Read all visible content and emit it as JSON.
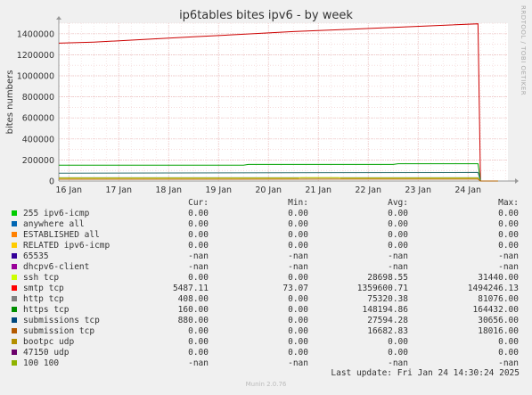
{
  "title": "ip6tables bites ipv6 - by week",
  "side_label": "RRDTOOL / TOBI OETIKER",
  "footer": {
    "last_update": "Last update: Fri Jan 24 14:30:24 2025",
    "munin": "Munin 2.0.76"
  },
  "legend_headers": {
    "cur": "Cur:",
    "min": "Min:",
    "avg": "Avg:",
    "max": "Max:"
  },
  "chart_data": {
    "type": "line",
    "title": "ip6tables bites ipv6 - by week",
    "ylabel": "bites numbers",
    "ylim": [
      0,
      1500000
    ],
    "yticks": [
      0,
      200000,
      400000,
      600000,
      800000,
      1000000,
      1200000,
      1400000
    ],
    "ytick_labels": [
      "0",
      "200000",
      "400000",
      "600000",
      "800000",
      "1000000",
      "1200000",
      "1400000"
    ],
    "xlim_days": [
      15.8,
      24.8
    ],
    "xticks": [
      16,
      17,
      18,
      19,
      20,
      21,
      22,
      23,
      24
    ],
    "xtick_labels": [
      "16 Jan",
      "17 Jan",
      "18 Jan",
      "19 Jan",
      "20 Jan",
      "21 Jan",
      "22 Jan",
      "23 Jan",
      "24 Jan"
    ],
    "grid": true,
    "series": [
      {
        "name": "smtp tcp",
        "color": "#cc0000",
        "x": [
          15.8,
          16.5,
          17.5,
          18.5,
          19.5,
          20.5,
          21.5,
          22.5,
          23.5,
          24.2,
          24.25,
          24.6
        ],
        "y": [
          1310000,
          1320000,
          1345000,
          1370000,
          1395000,
          1420000,
          1440000,
          1460000,
          1480000,
          1494246,
          0,
          0
        ]
      },
      {
        "name": "https tcp",
        "color": "#00a000",
        "x": [
          15.8,
          19.5,
          19.6,
          22.5,
          22.6,
          24.2,
          24.25,
          24.6
        ],
        "y": [
          150000,
          150000,
          158000,
          158000,
          164432,
          164432,
          0,
          0
        ]
      },
      {
        "name": "http tcp",
        "color": "#2f6f6f",
        "x": [
          15.8,
          24.2,
          24.25,
          24.6
        ],
        "y": [
          75000,
          81076,
          0,
          0
        ]
      },
      {
        "name": "submissions tcp",
        "color": "#104040",
        "x": [
          15.8,
          24.2,
          24.25,
          24.6
        ],
        "y": [
          30656,
          30656,
          0,
          0
        ]
      },
      {
        "name": "ssh tcp",
        "color": "#e0e000",
        "x": [
          15.8,
          20.6,
          20.65,
          21.4,
          21.45,
          24.2,
          24.25,
          24.6
        ],
        "y": [
          28000,
          28000,
          31440,
          31440,
          28000,
          28000,
          0,
          0
        ]
      },
      {
        "name": "submission tcp",
        "color": "#b06000",
        "x": [
          15.8,
          24.2,
          24.25,
          24.6
        ],
        "y": [
          16682,
          18016,
          0,
          0
        ]
      }
    ],
    "legend": [
      {
        "name": "255 ipv6-icmp",
        "color": "#00cc00",
        "cur": "0.00",
        "min": "0.00",
        "avg": "0.00",
        "max": "0.00"
      },
      {
        "name": "anywhere all",
        "color": "#0066b3",
        "cur": "0.00",
        "min": "0.00",
        "avg": "0.00",
        "max": "0.00"
      },
      {
        "name": "ESTABLISHED all",
        "color": "#ff8000",
        "cur": "0.00",
        "min": "0.00",
        "avg": "0.00",
        "max": "0.00"
      },
      {
        "name": "RELATED ipv6-icmp",
        "color": "#ffcc00",
        "cur": "0.00",
        "min": "0.00",
        "avg": "0.00",
        "max": "0.00"
      },
      {
        "name": "65535",
        "color": "#330099",
        "cur": "-nan",
        "min": "-nan",
        "avg": "-nan",
        "max": "-nan"
      },
      {
        "name": "dhcpv6-client",
        "color": "#990099",
        "cur": "-nan",
        "min": "-nan",
        "avg": "-nan",
        "max": "-nan"
      },
      {
        "name": "ssh tcp",
        "color": "#ccff00",
        "cur": "0.00",
        "min": "0.00",
        "avg": "28698.55",
        "max": "31440.00"
      },
      {
        "name": "smtp tcp",
        "color": "#ff0000",
        "cur": "5487.11",
        "min": "73.07",
        "avg": "1359600.71",
        "max": "1494246.13"
      },
      {
        "name": "http tcp",
        "color": "#808080",
        "cur": "408.00",
        "min": "0.00",
        "avg": "75320.38",
        "max": "81076.00"
      },
      {
        "name": "https tcp",
        "color": "#008f00",
        "cur": "160.00",
        "min": "0.00",
        "avg": "148194.86",
        "max": "164432.00"
      },
      {
        "name": "submissions tcp",
        "color": "#00487d",
        "cur": "880.00",
        "min": "0.00",
        "avg": "27594.28",
        "max": "30656.00"
      },
      {
        "name": "submission tcp",
        "color": "#b35a00",
        "cur": "0.00",
        "min": "0.00",
        "avg": "16682.83",
        "max": "18016.00"
      },
      {
        "name": "bootpc udp",
        "color": "#b38f00",
        "cur": "0.00",
        "min": "0.00",
        "avg": "0.00",
        "max": "0.00"
      },
      {
        "name": "47150 udp",
        "color": "#6b006b",
        "cur": "0.00",
        "min": "0.00",
        "avg": "0.00",
        "max": "0.00"
      },
      {
        "name": "100 100",
        "color": "#8fb300",
        "cur": "-nan",
        "min": "-nan",
        "avg": "-nan",
        "max": "-nan"
      }
    ]
  }
}
